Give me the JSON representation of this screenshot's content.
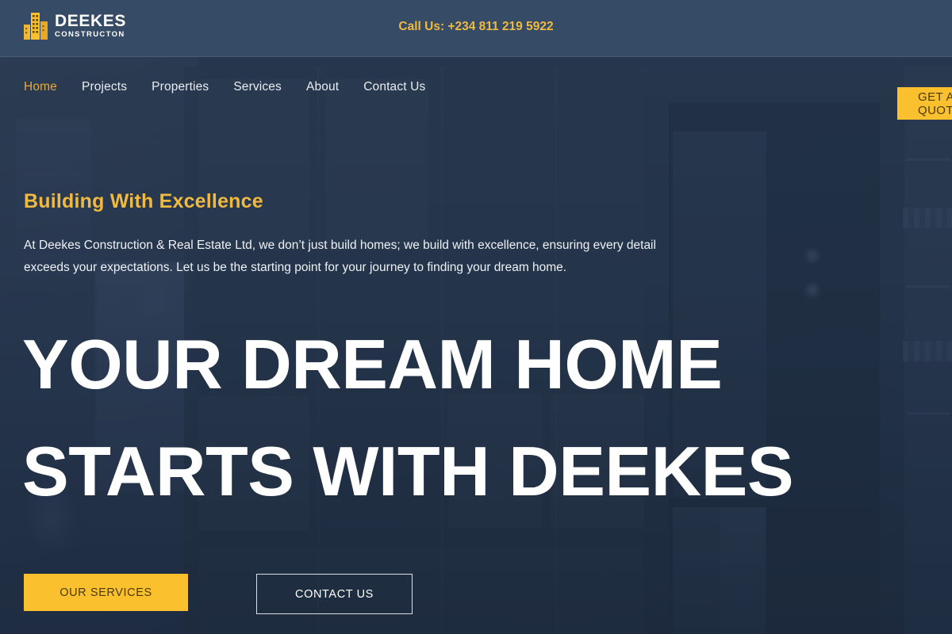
{
  "colors": {
    "header_bg": "#364b66",
    "gold": "#fbc02d",
    "gold_text": "#f0b93f",
    "nav_active": "#e8a736",
    "hero_bg": "#26374e",
    "white": "#ffffff"
  },
  "header": {
    "logo": {
      "icon": "building-icon",
      "name": "DEEKES",
      "subtitle": "CONSTRUCTON"
    },
    "phone": "Call Us: +234 811 219 5922"
  },
  "nav": {
    "items": [
      {
        "label": "Home",
        "active": true
      },
      {
        "label": "Projects",
        "active": false
      },
      {
        "label": "Properties",
        "active": false
      },
      {
        "label": "Services",
        "active": false
      },
      {
        "label": "About",
        "active": false
      },
      {
        "label": "Contact Us",
        "active": false
      }
    ],
    "quote_button": "GET A QUOTE"
  },
  "hero": {
    "eyebrow": "Building With Excellence",
    "lede": "At Deekes Construction & Real Estate Ltd, we don’t just build homes; we build with excellence, ensuring every detail exceeds your expectations. Let us be the starting point for your journey to finding your dream home.",
    "headline_line1": "YOUR DREAM HOME",
    "headline_line2": "STARTS WITH DEEKES",
    "cta_primary": "OUR SERVICES",
    "cta_secondary": "CONTACT US"
  }
}
